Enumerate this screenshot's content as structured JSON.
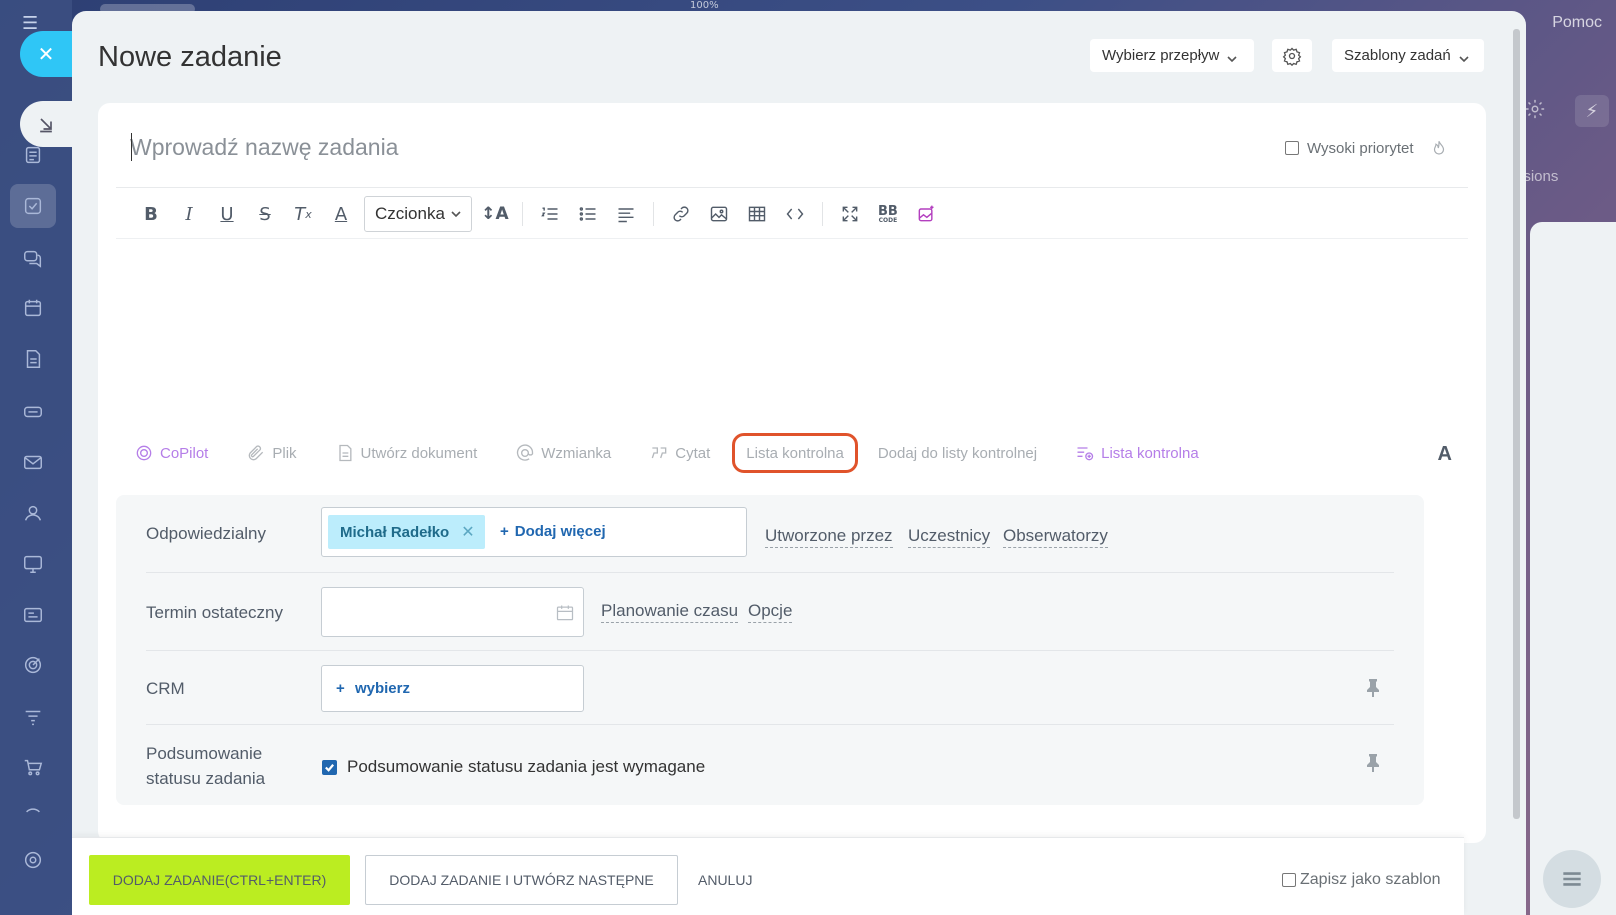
{
  "window": {
    "zoom_label": "100%",
    "help_label": "Pomoc",
    "right_ext_label": "nsions"
  },
  "portal_sidebar": {
    "icons": [
      "menu-icon",
      "home-icon",
      "feed-icon",
      "tasks-icon",
      "chat-icon",
      "calendar-icon",
      "documents-icon",
      "drive-icon",
      "mail-icon",
      "contacts-icon",
      "sites-icon",
      "crm-icon",
      "goals-icon",
      "filter-icon",
      "shop-icon",
      "collapse-icon",
      "settings-icon"
    ]
  },
  "header": {
    "title": "Nowe zadanie",
    "flow_label": "Wybierz przepływ",
    "templates_label": "Szablony zadań"
  },
  "editor": {
    "title_placeholder": "Wprowadź nazwę zadania",
    "high_priority_label": "Wysoki priorytet",
    "font_select_label": "Czcionka"
  },
  "actions": {
    "copilot": "CoPilot",
    "file": "Plik",
    "create_document": "Utwórz dokument",
    "mention": "Wzmianka",
    "quote": "Cytat",
    "checklist": "Lista kontrolna",
    "add_to_checklist": "Dodaj do listy kontrolnej",
    "checklist2": "Lista kontrolna",
    "font_toggle": "A"
  },
  "fields": {
    "responsible_label": "Odpowiedzialny",
    "responsible_person": "Michał Radełko",
    "add_more": "Dodaj więcej",
    "created_by": "Utworzone przez",
    "participants": "Uczestnicy",
    "observers": "Obserwatorzy",
    "deadline_label": "Termin ostateczny",
    "time_planning": "Planowanie czasu",
    "options": "Opcje",
    "crm_label": "CRM",
    "crm_select": "wybierz",
    "summary_label_1": "Podsumowanie",
    "summary_label_2": "statusu zadania",
    "summary_checkbox": "Podsumowanie statusu zadania jest wymagane"
  },
  "footer": {
    "add_task": "DODAJ ZADANIE(CTRL+ENTER)",
    "add_and_next": "DODAJ ZADANIE I UTWÓRZ NASTĘPNE",
    "cancel": "ANULUJ",
    "save_template": "Zapisz jako szablon"
  },
  "colors": {
    "accent": "#2fc6f6",
    "primary_button": "#bbed21",
    "link": "#2067b0",
    "highlight_outline": "#e0532b",
    "copilot": "#b57ee8"
  }
}
